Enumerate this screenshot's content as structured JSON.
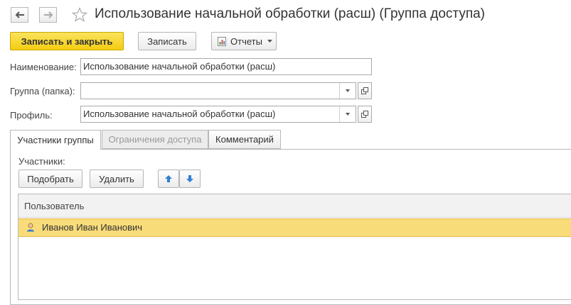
{
  "window": {
    "title": "Использование начальной обработки (расш) (Группа доступа)"
  },
  "toolbar": {
    "save_close_label": "Записать и закрыть",
    "save_label": "Записать",
    "reports_label": "Отчеты"
  },
  "form": {
    "name_label": "Наименование:",
    "name_value": "Использование начальной обработки (расш)",
    "group_label": "Группа (папка):",
    "group_value": "",
    "profile_label": "Профиль:",
    "profile_value": "Использование начальной обработки (расш)"
  },
  "tabs": [
    {
      "label": "Участники группы"
    },
    {
      "label": "Ограничения доступа"
    },
    {
      "label": "Комментарий"
    }
  ],
  "members": {
    "label": "Участники:",
    "pick_label": "Подобрать",
    "delete_label": "Удалить",
    "column_header": "Пользователь",
    "rows": [
      {
        "name": "Иванов Иван Иванович"
      }
    ]
  },
  "colors": {
    "accent_yellow": "#f4cd11",
    "selected_row": "#f9dc7a",
    "arrow_blue": "#2f7fd4"
  },
  "icons": {
    "back": "arrow-left-icon",
    "forward": "arrow-right-icon",
    "favorite": "star-icon",
    "reports": "report-icon",
    "dropdown": "triangle-down-icon",
    "open": "open-window-icon",
    "move_up": "arrow-up-icon",
    "move_down": "arrow-down-icon",
    "user": "user-icon"
  }
}
